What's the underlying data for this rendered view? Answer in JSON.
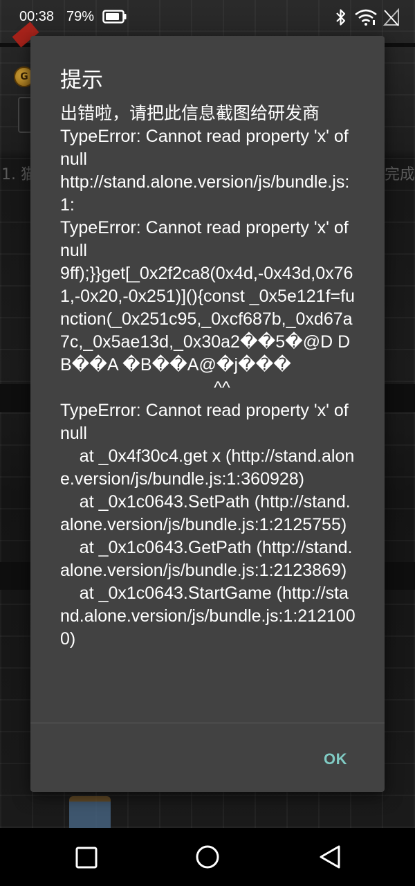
{
  "status_bar": {
    "time": "00:38",
    "battery_percent": "79%",
    "icons": [
      "battery-icon",
      "bluetooth-icon",
      "wifi-icon",
      "no-signal-icon"
    ]
  },
  "background": {
    "coin_label": "G",
    "task_left": "1. 猫",
    "task_right": "完成"
  },
  "dialog": {
    "title": "提示",
    "message": "出错啦，请把此信息截图给研发商\nTypeError: Cannot read property 'x' of null\nhttp://stand.alone.version/js/bundle.js:1:\nTypeError: Cannot read property 'x' of null\n9ff);}}get[_0x2f2ca8(0x4d,-0x43d,0x761,-0x20,-0x251)](){const _0x5e121f=function(_0x251c95,_0xcf687b,_0xd67a7c,_0x5ae13d,_0x30a2��5�@D DB��A �B��A@�j���\n                                ^^\nTypeError: Cannot read property 'x' of null\n    at _0x4f30c4.get x (http://stand.alone.version/js/bundle.js:1:360928)\n    at _0x1c0643.SetPath (http://stand.alone.version/js/bundle.js:1:2125755)\n    at _0x1c0643.GetPath (http://stand.alone.version/js/bundle.js:1:2123869)\n    at _0x1c0643.StartGame (http://stand.alone.version/js/bundle.js:1:2121000)",
    "ok_label": "OK",
    "accent_color": "#80cbc4",
    "background_color": "#424242"
  },
  "nav_bar": {
    "icons": [
      "recents-square-icon",
      "home-circle-icon",
      "back-triangle-icon"
    ]
  }
}
